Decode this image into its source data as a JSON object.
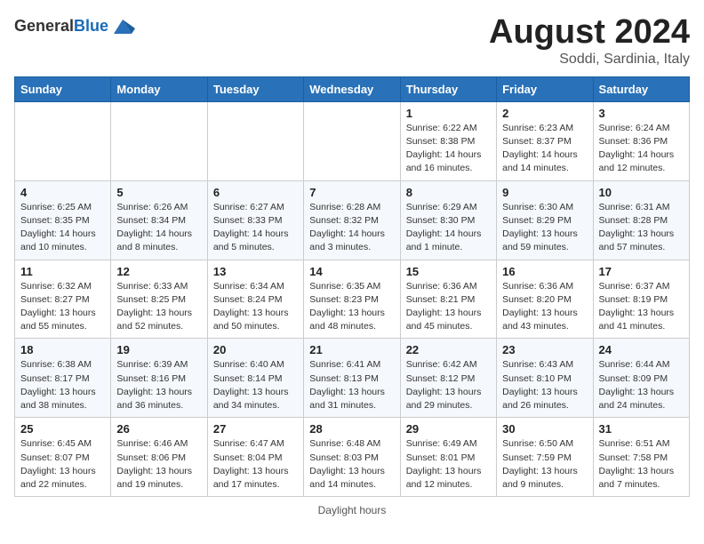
{
  "header": {
    "logo_general": "General",
    "logo_blue": "Blue",
    "title": "August 2024",
    "location": "Soddi, Sardinia, Italy"
  },
  "weekdays": [
    "Sunday",
    "Monday",
    "Tuesday",
    "Wednesday",
    "Thursday",
    "Friday",
    "Saturday"
  ],
  "weeks": [
    [
      {
        "day": "",
        "info": ""
      },
      {
        "day": "",
        "info": ""
      },
      {
        "day": "",
        "info": ""
      },
      {
        "day": "",
        "info": ""
      },
      {
        "day": "1",
        "info": "Sunrise: 6:22 AM\nSunset: 8:38 PM\nDaylight: 14 hours and 16 minutes."
      },
      {
        "day": "2",
        "info": "Sunrise: 6:23 AM\nSunset: 8:37 PM\nDaylight: 14 hours and 14 minutes."
      },
      {
        "day": "3",
        "info": "Sunrise: 6:24 AM\nSunset: 8:36 PM\nDaylight: 14 hours and 12 minutes."
      }
    ],
    [
      {
        "day": "4",
        "info": "Sunrise: 6:25 AM\nSunset: 8:35 PM\nDaylight: 14 hours and 10 minutes."
      },
      {
        "day": "5",
        "info": "Sunrise: 6:26 AM\nSunset: 8:34 PM\nDaylight: 14 hours and 8 minutes."
      },
      {
        "day": "6",
        "info": "Sunrise: 6:27 AM\nSunset: 8:33 PM\nDaylight: 14 hours and 5 minutes."
      },
      {
        "day": "7",
        "info": "Sunrise: 6:28 AM\nSunset: 8:32 PM\nDaylight: 14 hours and 3 minutes."
      },
      {
        "day": "8",
        "info": "Sunrise: 6:29 AM\nSunset: 8:30 PM\nDaylight: 14 hours and 1 minute."
      },
      {
        "day": "9",
        "info": "Sunrise: 6:30 AM\nSunset: 8:29 PM\nDaylight: 13 hours and 59 minutes."
      },
      {
        "day": "10",
        "info": "Sunrise: 6:31 AM\nSunset: 8:28 PM\nDaylight: 13 hours and 57 minutes."
      }
    ],
    [
      {
        "day": "11",
        "info": "Sunrise: 6:32 AM\nSunset: 8:27 PM\nDaylight: 13 hours and 55 minutes."
      },
      {
        "day": "12",
        "info": "Sunrise: 6:33 AM\nSunset: 8:25 PM\nDaylight: 13 hours and 52 minutes."
      },
      {
        "day": "13",
        "info": "Sunrise: 6:34 AM\nSunset: 8:24 PM\nDaylight: 13 hours and 50 minutes."
      },
      {
        "day": "14",
        "info": "Sunrise: 6:35 AM\nSunset: 8:23 PM\nDaylight: 13 hours and 48 minutes."
      },
      {
        "day": "15",
        "info": "Sunrise: 6:36 AM\nSunset: 8:21 PM\nDaylight: 13 hours and 45 minutes."
      },
      {
        "day": "16",
        "info": "Sunrise: 6:36 AM\nSunset: 8:20 PM\nDaylight: 13 hours and 43 minutes."
      },
      {
        "day": "17",
        "info": "Sunrise: 6:37 AM\nSunset: 8:19 PM\nDaylight: 13 hours and 41 minutes."
      }
    ],
    [
      {
        "day": "18",
        "info": "Sunrise: 6:38 AM\nSunset: 8:17 PM\nDaylight: 13 hours and 38 minutes."
      },
      {
        "day": "19",
        "info": "Sunrise: 6:39 AM\nSunset: 8:16 PM\nDaylight: 13 hours and 36 minutes."
      },
      {
        "day": "20",
        "info": "Sunrise: 6:40 AM\nSunset: 8:14 PM\nDaylight: 13 hours and 34 minutes."
      },
      {
        "day": "21",
        "info": "Sunrise: 6:41 AM\nSunset: 8:13 PM\nDaylight: 13 hours and 31 minutes."
      },
      {
        "day": "22",
        "info": "Sunrise: 6:42 AM\nSunset: 8:12 PM\nDaylight: 13 hours and 29 minutes."
      },
      {
        "day": "23",
        "info": "Sunrise: 6:43 AM\nSunset: 8:10 PM\nDaylight: 13 hours and 26 minutes."
      },
      {
        "day": "24",
        "info": "Sunrise: 6:44 AM\nSunset: 8:09 PM\nDaylight: 13 hours and 24 minutes."
      }
    ],
    [
      {
        "day": "25",
        "info": "Sunrise: 6:45 AM\nSunset: 8:07 PM\nDaylight: 13 hours and 22 minutes."
      },
      {
        "day": "26",
        "info": "Sunrise: 6:46 AM\nSunset: 8:06 PM\nDaylight: 13 hours and 19 minutes."
      },
      {
        "day": "27",
        "info": "Sunrise: 6:47 AM\nSunset: 8:04 PM\nDaylight: 13 hours and 17 minutes."
      },
      {
        "day": "28",
        "info": "Sunrise: 6:48 AM\nSunset: 8:03 PM\nDaylight: 13 hours and 14 minutes."
      },
      {
        "day": "29",
        "info": "Sunrise: 6:49 AM\nSunset: 8:01 PM\nDaylight: 13 hours and 12 minutes."
      },
      {
        "day": "30",
        "info": "Sunrise: 6:50 AM\nSunset: 7:59 PM\nDaylight: 13 hours and 9 minutes."
      },
      {
        "day": "31",
        "info": "Sunrise: 6:51 AM\nSunset: 7:58 PM\nDaylight: 13 hours and 7 minutes."
      }
    ]
  ],
  "footer": {
    "daylight_label": "Daylight hours"
  }
}
